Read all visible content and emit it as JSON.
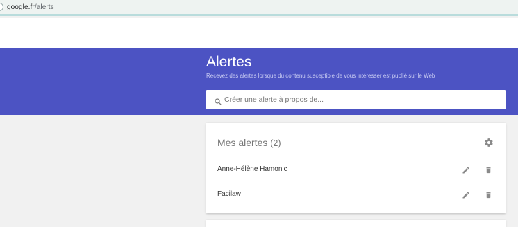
{
  "browser": {
    "url_host": "google.fr",
    "url_path": "/alerts"
  },
  "hero": {
    "title": "Alertes",
    "subtitle": "Recevez des alertes lorsque du contenu susceptible de vous intéresser est publié sur le Web",
    "search_placeholder": "Créer une alerte à propos de..."
  },
  "alerts_card": {
    "heading": "Mes alertes",
    "count": "(2)",
    "items": [
      {
        "label": "Anne-Hélène Hamonic"
      },
      {
        "label": "Facilaw"
      }
    ]
  },
  "colors": {
    "hero_bg": "#4c53c3",
    "page_bg": "#f1f1f1",
    "icon_gray": "#8a8a8a"
  },
  "icons": [
    "globe-icon",
    "search-icon",
    "gear-icon",
    "pencil-icon",
    "trash-icon"
  ]
}
